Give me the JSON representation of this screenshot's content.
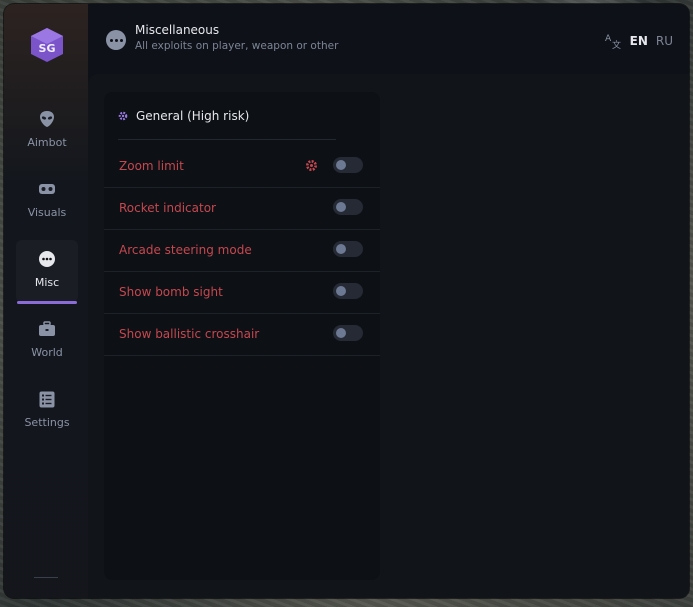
{
  "header": {
    "title": "Miscellaneous",
    "subtitle": "All exploits on player, weapon or other"
  },
  "language": {
    "options": [
      "EN",
      "RU"
    ],
    "selected": "EN"
  },
  "sidebar": {
    "items": [
      {
        "label": "Aimbot",
        "icon": "alien-icon"
      },
      {
        "label": "Visuals",
        "icon": "vr-headset-icon"
      },
      {
        "label": "Misc",
        "icon": "more-dots-icon",
        "active": true
      },
      {
        "label": "World",
        "icon": "briefcase-icon"
      },
      {
        "label": "Settings",
        "icon": "list-settings-icon"
      }
    ]
  },
  "panel": {
    "title": "General (High risk)",
    "items": [
      {
        "label": "Zoom limit",
        "has_settings": true,
        "enabled": false
      },
      {
        "label": "Rocket indicator",
        "enabled": false
      },
      {
        "label": "Arcade steering mode",
        "enabled": false
      },
      {
        "label": "Show bomb sight",
        "enabled": false
      },
      {
        "label": "Show ballistic crosshair",
        "enabled": false
      }
    ]
  },
  "colors": {
    "accent": "#8a6bd8",
    "risk_text": "#c5484f",
    "background": "#0e1117"
  }
}
